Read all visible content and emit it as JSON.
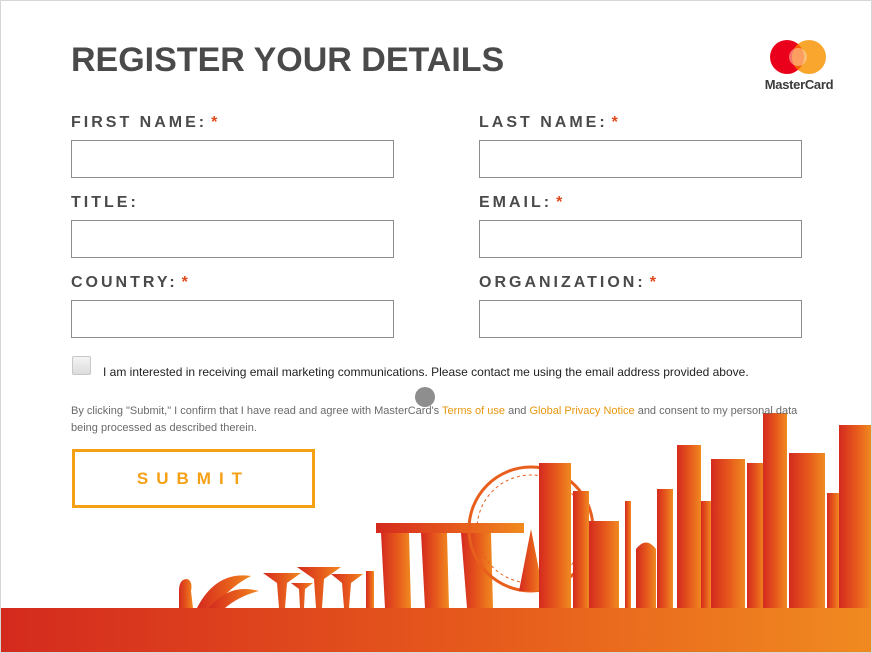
{
  "header": {
    "title": "REGISTER YOUR DETAILS",
    "brand_name": "MasterCard"
  },
  "form": {
    "first_name": {
      "label": "FIRST NAME:",
      "required_mark": "*",
      "value": ""
    },
    "last_name": {
      "label": "LAST NAME:",
      "required_mark": "*",
      "value": ""
    },
    "title": {
      "label": "TITLE:",
      "value": ""
    },
    "email": {
      "label": "EMAIL:",
      "required_mark": "*",
      "value": ""
    },
    "country": {
      "label": "COUNTRY:",
      "required_mark": "*",
      "value": ""
    },
    "organization": {
      "label": "ORGANIZATION:",
      "required_mark": "*",
      "value": ""
    },
    "marketing_checkbox": {
      "checked": false,
      "label": "I am interested in receiving email marketing communications. Please contact me using the email address provided above."
    },
    "legal": {
      "text_before": "By clicking \"Submit,\" I confirm that I have read and agree with MasterCard's ",
      "terms_link": "Terms of use",
      "text_and": " and ",
      "privacy_link": "Global Privacy Notice",
      "text_after": " and consent to my personal data being processed as described therein."
    },
    "submit_label": "SUBMIT"
  },
  "colors": {
    "accent_orange": "#f5a015",
    "required_red": "#e04a1a",
    "logo_red": "#eb001b",
    "logo_yellow": "#f79e1b",
    "skyline_start": "#d42a1e",
    "skyline_end": "#f08a20"
  },
  "icons": {
    "logo": "mastercard-logo-icon",
    "cursor": "pointer-dot-icon",
    "decoration": "singapore-skyline-illustration"
  }
}
